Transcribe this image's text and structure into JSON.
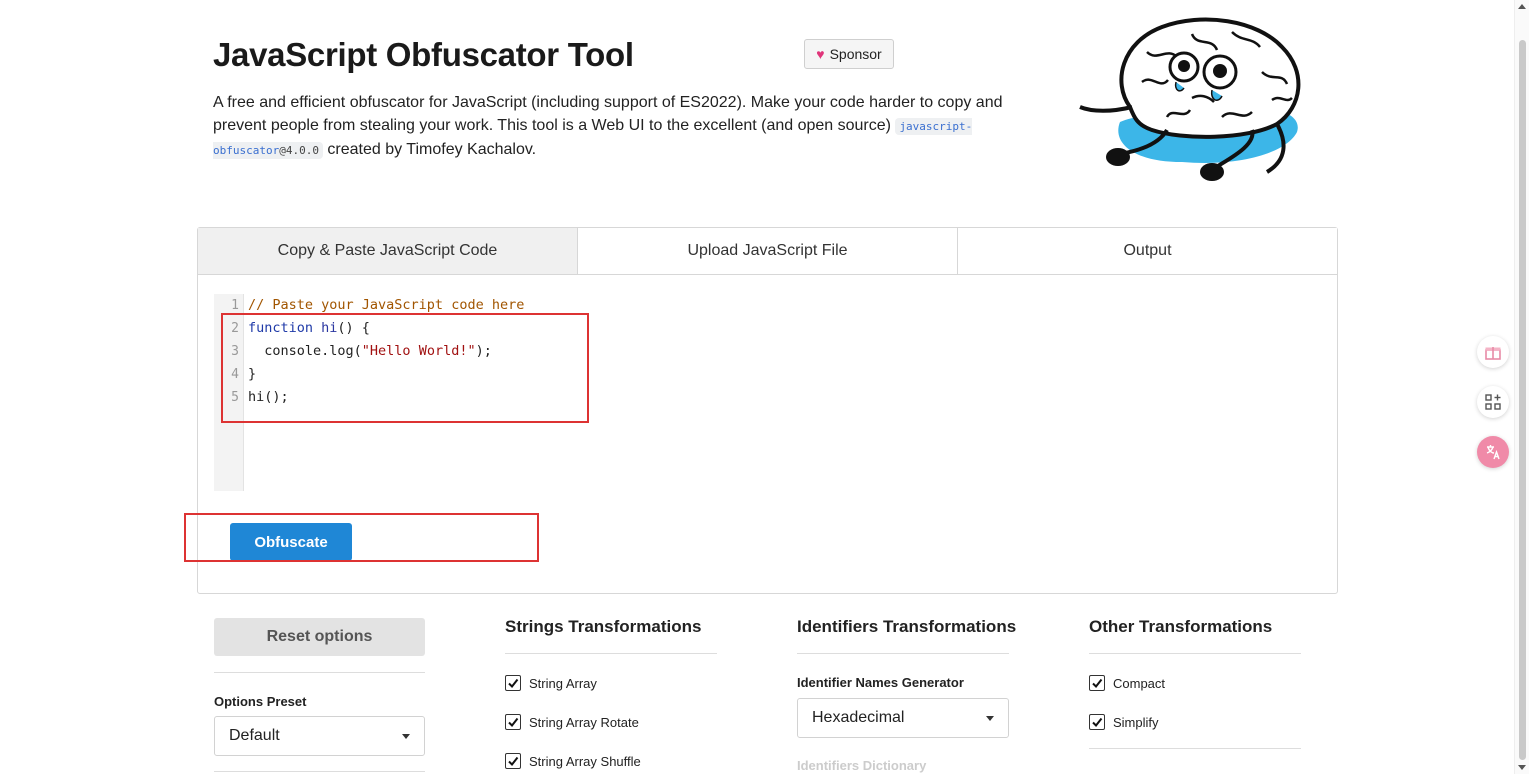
{
  "header": {
    "title": "JavaScript Obfuscator Tool",
    "desc_part1": "A free and efficient obfuscator for JavaScript (including support of ES2022). Make your code harder to copy and prevent people from stealing your work. This tool is a Web UI to the excellent (and open source) ",
    "chip_lib": "javascript-obfuscator",
    "chip_version": "@4.0.0",
    "desc_part2": " created by Timofey Kachalov.",
    "sponsor_label": "Sponsor"
  },
  "tabs": [
    {
      "label": "Copy & Paste JavaScript Code",
      "active": true
    },
    {
      "label": "Upload JavaScript File",
      "active": false
    },
    {
      "label": "Output",
      "active": false
    }
  ],
  "editor": {
    "line_numbers": [
      "1",
      "2",
      "3",
      "4",
      "5"
    ],
    "lines": {
      "l1": "// Paste your JavaScript code here",
      "l2_kw": "function",
      "l2_fn": " hi",
      "l2_rest": "() {",
      "l3_pre": "  console.log(",
      "l3_str": "\"Hello World!\"",
      "l3_post": ");",
      "l4": "}",
      "l5": "hi();"
    }
  },
  "obfuscate_label": "Obfuscate",
  "options": {
    "reset_label": "Reset options",
    "preset_label": "Options Preset",
    "preset_value": "Default",
    "strings": {
      "title": "Strings Transformations",
      "items": [
        {
          "label": "String Array",
          "checked": true
        },
        {
          "label": "String Array Rotate",
          "checked": true
        },
        {
          "label": "String Array Shuffle",
          "checked": true
        }
      ]
    },
    "identifiers": {
      "title": "Identifiers Transformations",
      "generator_label": "Identifier Names Generator",
      "generator_value": "Hexadecimal",
      "dictionary_label": "Identifiers Dictionary"
    },
    "other": {
      "title": "Other Transformations",
      "items": [
        {
          "label": "Compact",
          "checked": true
        },
        {
          "label": "Simplify",
          "checked": true
        }
      ]
    }
  },
  "colors": {
    "accent": "#1f87d6",
    "highlight_box": "#dd3333",
    "heart": "#e0357a"
  },
  "icons": [
    "heart-icon",
    "gift-icon",
    "apps-add-icon",
    "translate-icon",
    "checkmark-icon",
    "caret-down-icon"
  ]
}
